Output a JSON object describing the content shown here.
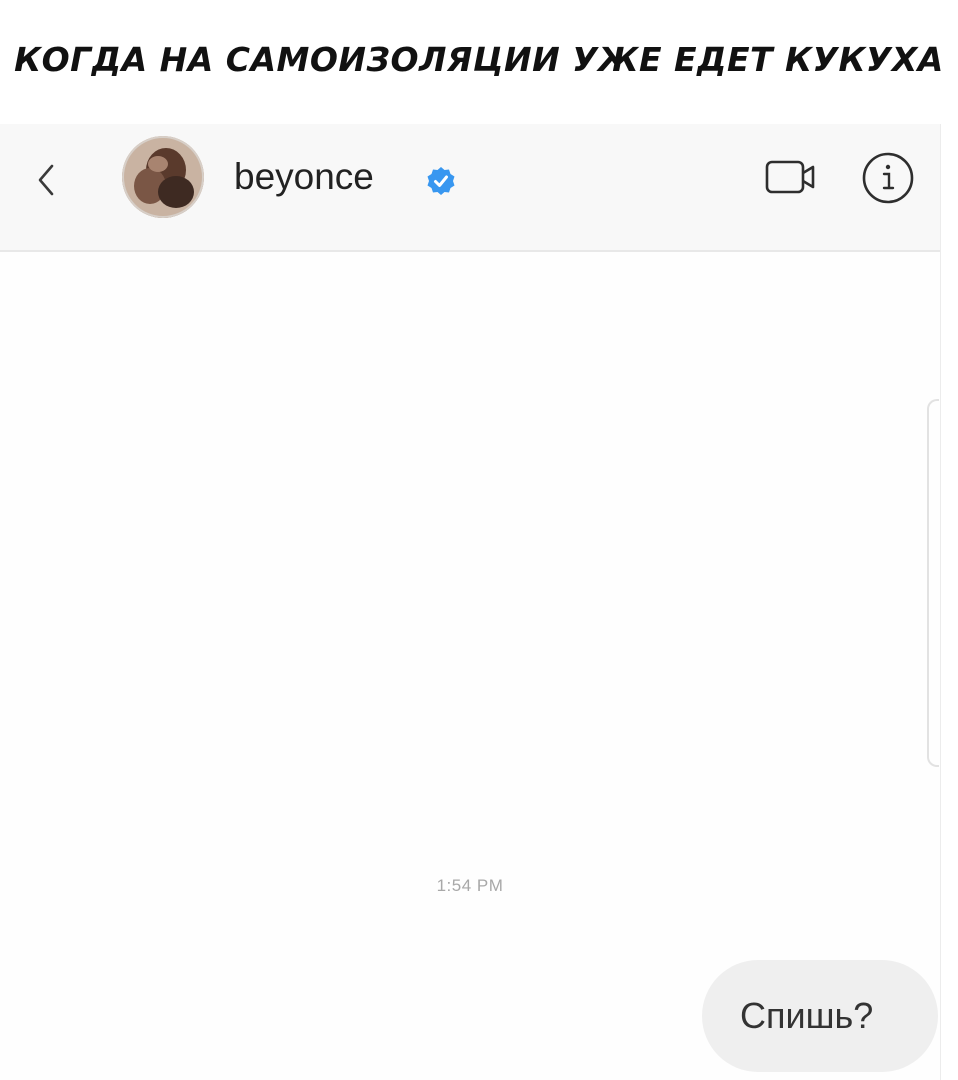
{
  "caption": "КОГДА НА САМОИЗОЛЯЦИИ УЖЕ ЕДЕТ КУКУХА",
  "chat": {
    "username": "beyonce",
    "verified": true,
    "accent_color": "#3897f0",
    "icons": {
      "back": "chevron-left-icon",
      "avatar": "profile-photo",
      "verified": "verified-badge-icon",
      "video": "video-camera-icon",
      "info": "info-icon"
    }
  },
  "messages": [
    {
      "timestamp": "1:54 PM",
      "text": "Спишь?",
      "sender": "me"
    }
  ]
}
